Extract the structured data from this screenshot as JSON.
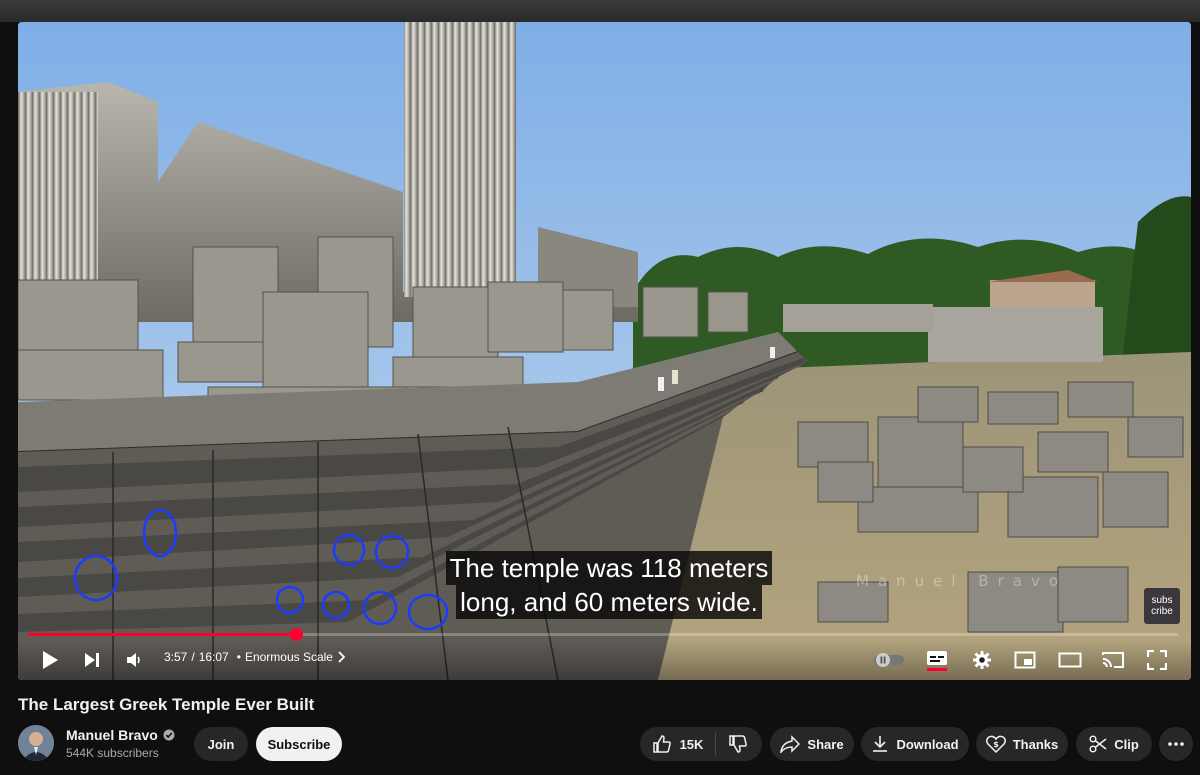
{
  "video": {
    "caption_line1": "The temple was 118 meters",
    "caption_line2": "long, and 60 meters wide.",
    "watermark": "Manuel Bravo",
    "subscribe_badge": "subs cribe",
    "progress_fraction": 0.2327
  },
  "controls": {
    "current_time": "3:57",
    "separator": "/",
    "duration": "16:07",
    "chapter": "Enormous Scale"
  },
  "title": "The Largest Greek Temple Ever Built",
  "channel": {
    "name": "Manuel Bravo",
    "subscribers": "544K subscribers",
    "join_label": "Join",
    "subscribe_label": "Subscribe"
  },
  "actions": {
    "likes": "15K",
    "share": "Share",
    "download": "Download",
    "thanks": "Thanks",
    "clip": "Clip"
  },
  "icons": [
    "play-icon",
    "next-icon",
    "volume-icon",
    "chevron-right-icon",
    "autoplay-toggle-icon",
    "captions-icon",
    "settings-icon",
    "miniplayer-icon",
    "theater-icon",
    "cast-icon",
    "fullscreen-icon",
    "verified-icon",
    "like-icon",
    "dislike-icon",
    "share-icon",
    "download-icon",
    "thanks-icon",
    "clip-icon",
    "more-icon"
  ],
  "colors": {
    "accent_red": "#ff0033",
    "annotation_blue": "#1a3cff",
    "background": "#0f0f0f",
    "pill": "#272727"
  }
}
